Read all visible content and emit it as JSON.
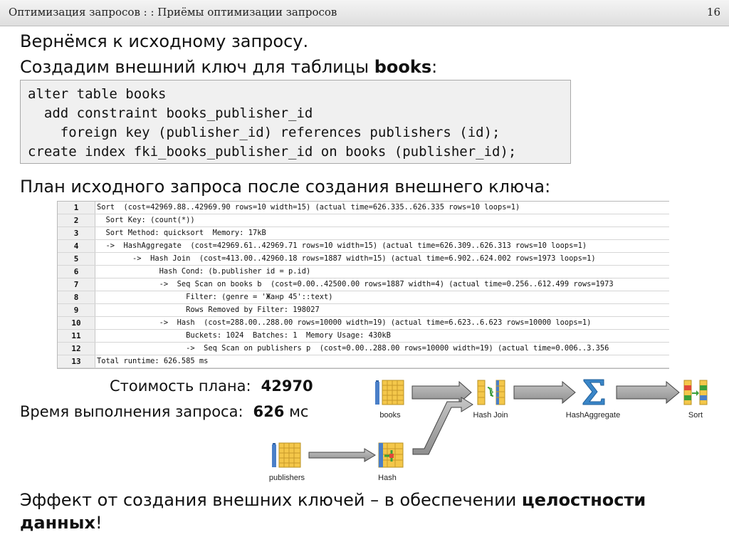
{
  "header": {
    "title": "Оптимизация запросов : : Приёмы оптимизации запросов",
    "page_number": "16"
  },
  "intro": {
    "line1": "Вернёмся к исходному запросу.",
    "line2_prefix": "Создадим внешний ключ для таблицы ",
    "line2_bold": "books",
    "line2_suffix": ":"
  },
  "code_block": {
    "lines": [
      "alter table books",
      "  add constraint books_publisher_id",
      "    foreign key (publisher_id) references publishers (id);",
      "create index fki_books_publisher_id on books (publisher_id);"
    ]
  },
  "plan_heading": "План исходного запроса после создания внешнего ключа:",
  "plan_rows": [
    {
      "n": "1",
      "text": "Sort  (cost=42969.88..42969.90 rows=10 width=15) (actual time=626.335..626.335 rows=10 loops=1)"
    },
    {
      "n": "2",
      "text": "  Sort Key: (count(*))"
    },
    {
      "n": "3",
      "text": "  Sort Method: quicksort  Memory: 17kB"
    },
    {
      "n": "4",
      "text": "  ->  HashAggregate  (cost=42969.61..42969.71 rows=10 width=15) (actual time=626.309..626.313 rows=10 loops=1)"
    },
    {
      "n": "5",
      "text": "        ->  Hash Join  (cost=413.00..42960.18 rows=1887 width=15) (actual time=6.902..624.002 rows=1973 loops=1)"
    },
    {
      "n": "6",
      "text": "              Hash Cond: (b.publisher id = p.id)"
    },
    {
      "n": "7",
      "text": "              ->  Seq Scan on books b  (cost=0.00..42500.00 rows=1887 width=4) (actual time=0.256..612.499 rows=1973"
    },
    {
      "n": "8",
      "text": "                    Filter: (genre = 'Жанр 45'::text)"
    },
    {
      "n": "9",
      "text": "                    Rows Removed by Filter: 198027"
    },
    {
      "n": "10",
      "text": "              ->  Hash  (cost=288.00..288.00 rows=10000 width=19) (actual time=6.623..6.623 rows=10000 loops=1)"
    },
    {
      "n": "11",
      "text": "                    Buckets: 1024  Batches: 1  Memory Usage: 430kB"
    },
    {
      "n": "12",
      "text": "                    ->  Seq Scan on publishers p  (cost=0.00..288.00 rows=10000 width=19) (actual time=0.006..3.356"
    },
    {
      "n": "13",
      "text": "Total runtime: 626.585 ms"
    }
  ],
  "metrics": {
    "cost_label": "Стоимость плана:",
    "cost_value": "42970",
    "time_label": "Время выполнения запроса:",
    "time_value": "626",
    "time_unit": "мс"
  },
  "diagram": {
    "nodes": {
      "books": "books",
      "hash_join": "Hash Join",
      "hash_aggregate": "HashAggregate",
      "sort": "Sort",
      "publishers": "publishers",
      "hash": "Hash"
    }
  },
  "conclusion": {
    "prefix": "Эффект от создания внешних ключей – в обеспечении ",
    "bold": "целостности данных",
    "suffix": "!"
  },
  "colors": {
    "header_bg": "#e6e6e6",
    "code_bg": "#f0f0f0",
    "plan_num_bg": "#efefef",
    "table_icon_yellow": "#f4c74a",
    "table_icon_blue": "#4a7fc8",
    "arrow_gray": "#a8a8a8",
    "sigma_blue": "#3a86c8"
  }
}
